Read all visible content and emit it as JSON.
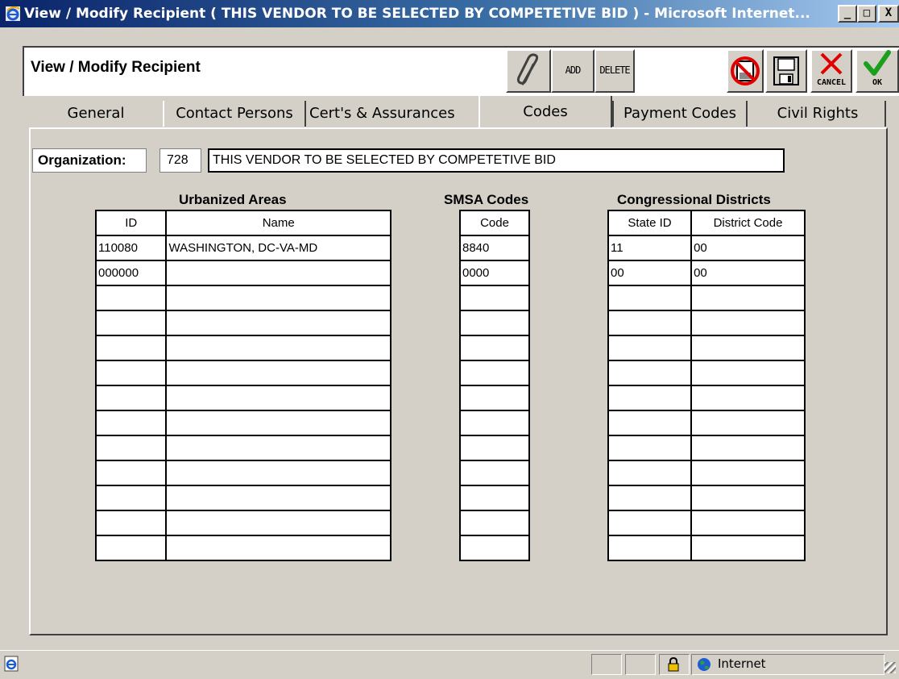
{
  "window": {
    "title": "View / Modify Recipient ( THIS VENDOR TO BE SELECTED BY COMPETETIVE BID ) - Microsoft Internet...",
    "minimize": "_",
    "maximize": "□",
    "close": "X"
  },
  "header": {
    "title": "View / Modify Recipient",
    "add_label": "ADD",
    "delete_label": "DELETE",
    "cancel_label": "CANCEL",
    "ok_label": "OK"
  },
  "tabs": [
    {
      "label": "General"
    },
    {
      "label": "Contact Persons"
    },
    {
      "label": "Cert's & Assurances"
    },
    {
      "label": "Codes"
    },
    {
      "label": "Payment Codes"
    },
    {
      "label": "Civil Rights"
    }
  ],
  "organization": {
    "label": "Organization:",
    "id": "728",
    "name": "THIS VENDOR TO BE SELECTED BY COMPETETIVE BID"
  },
  "urbanized_areas": {
    "title": "Urbanized Areas",
    "columns": [
      "ID",
      "Name"
    ],
    "rows": [
      [
        "110080",
        "WASHINGTON, DC-VA-MD"
      ],
      [
        "000000",
        ""
      ],
      [
        "",
        ""
      ],
      [
        "",
        ""
      ],
      [
        "",
        ""
      ],
      [
        "",
        ""
      ],
      [
        "",
        ""
      ],
      [
        "",
        ""
      ],
      [
        "",
        ""
      ],
      [
        "",
        ""
      ],
      [
        "",
        ""
      ],
      [
        "",
        ""
      ],
      [
        "",
        ""
      ]
    ]
  },
  "smsa_codes": {
    "title": "SMSA Codes",
    "columns": [
      "Code"
    ],
    "rows": [
      [
        "8840"
      ],
      [
        "0000"
      ],
      [
        ""
      ],
      [
        ""
      ],
      [
        ""
      ],
      [
        ""
      ],
      [
        ""
      ],
      [
        ""
      ],
      [
        ""
      ],
      [
        ""
      ],
      [
        ""
      ],
      [
        ""
      ],
      [
        ""
      ]
    ]
  },
  "congressional_districts": {
    "title": "Congressional Districts",
    "columns": [
      "State ID",
      "District Code"
    ],
    "rows": [
      [
        "11",
        "00"
      ],
      [
        "00",
        "00"
      ],
      [
        "",
        ""
      ],
      [
        "",
        ""
      ],
      [
        "",
        ""
      ],
      [
        "",
        ""
      ],
      [
        "",
        ""
      ],
      [
        "",
        ""
      ],
      [
        "",
        ""
      ],
      [
        "",
        ""
      ],
      [
        "",
        ""
      ],
      [
        "",
        ""
      ],
      [
        "",
        ""
      ]
    ]
  },
  "statusbar": {
    "zone": "Internet"
  },
  "icons": {
    "title_icon": "ie-icon",
    "attach": "paperclip-icon",
    "no_print": "no-print-icon",
    "save": "floppy-save-icon",
    "cancel": "red-x-icon",
    "ok": "green-check-icon",
    "lock": "lock-icon",
    "zone": "globe-icon",
    "page": "page-icon"
  },
  "colors": {
    "titlebar_start": "#0a246a",
    "titlebar_end": "#a6caf0",
    "face": "#d4d0c8",
    "cancel_red": "#e00000",
    "ok_green": "#1aa01a"
  }
}
